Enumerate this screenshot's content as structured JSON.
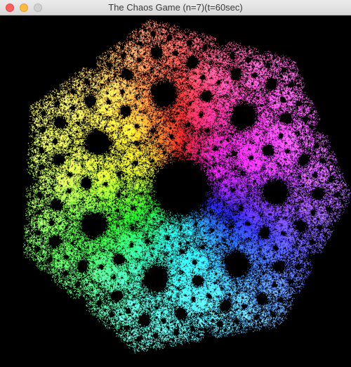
{
  "window": {
    "title": "The Chaos Game (n=7)(t=60sec)"
  },
  "plot": {
    "vertex_count": 7,
    "background_color": "#000000"
  }
}
